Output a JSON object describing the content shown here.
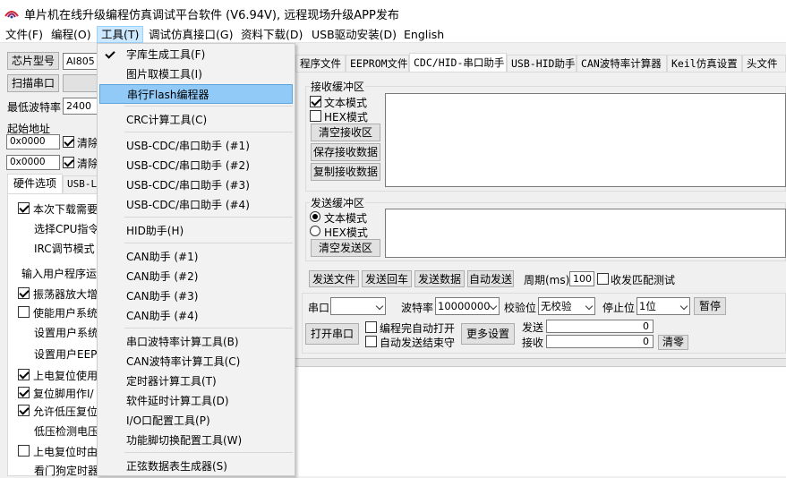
{
  "window": {
    "title": "单片机在线升级编程仿真调试平台软件 (V6.94V), 远程现场升级APP发布"
  },
  "menubar": {
    "file": "文件(F)",
    "program": "编程(O)",
    "tools": "工具(T)",
    "debug": "调试仿真接口(G)",
    "download": "资料下载(D)",
    "usb": "USB驱动安装(D)",
    "english": "English"
  },
  "left": {
    "chip_label": "芯片型号",
    "chip_value": "AI805",
    "scan_port": "扫描串口",
    "min_baud_label": "最低波特率",
    "min_baud_value": "2400",
    "start_addr_label": "起始地址",
    "addr1": "0x0000",
    "clear1": "清除",
    "addr2": "0x0000",
    "clear2": "清除",
    "tab_hw": "硬件选项",
    "tab_usb": "USB-L",
    "items": [
      {
        "label": "本次下载需要",
        "checked": true
      },
      {
        "label": "选择CPU指令",
        "checked": null
      },
      {
        "label": "IRC调节模式",
        "checked": null
      },
      {
        "label": "输入用户程序运",
        "checked": null
      },
      {
        "label": "振荡器放大增",
        "checked": true
      },
      {
        "label": "使能用户系统",
        "checked": false
      },
      {
        "label": "设置用户系统",
        "checked": null
      },
      {
        "label": "设置用户EEPR",
        "checked": null
      },
      {
        "label": "上电复位使用",
        "checked": true
      },
      {
        "label": "复位脚用作I/",
        "checked": true
      },
      {
        "label": "允许低压复位",
        "checked": true
      },
      {
        "label": "低压检测电压",
        "checked": null
      },
      {
        "label": "上电复位时由",
        "checked": false
      },
      {
        "label": "看门狗定时器",
        "checked": null
      }
    ]
  },
  "tabs": [
    "程序文件",
    "EEPROM文件",
    "CDC/HID-串口助手",
    "USB-HID助手",
    "CAN波特率计算器",
    "Keil仿真设置",
    "头文件"
  ],
  "receive": {
    "title": "接收缓冲区",
    "text_mode": "文本模式",
    "hex_mode": "HEX模式",
    "clear": "清空接收区",
    "save": "保存接收数据",
    "copy": "复制接收数据"
  },
  "send": {
    "title": "发送缓冲区",
    "text_mode": "文本模式",
    "hex_mode": "HEX模式",
    "clear": "清空发送区",
    "send_file": "发送文件",
    "send_return": "发送回车",
    "send_data": "发送数据",
    "auto_send": "自动发送",
    "period_label": "周期(ms)",
    "period_value": "100",
    "match_test": "收发匹配测试"
  },
  "serial": {
    "port_label": "串口",
    "baud_label": "波特率",
    "baud_value": "10000000",
    "parity_label": "校验位",
    "parity_value": "无校验",
    "stop_label": "停止位",
    "stop_value": "1位",
    "pause": "暂停",
    "open": "打开串口",
    "auto_open": "编程完自动打开",
    "auto_close": "自动发送结束守",
    "more": "更多设置",
    "send_label": "发送",
    "send_count": "0",
    "recv_label": "接收",
    "recv_count": "0",
    "clear": "清零"
  },
  "dropdown": {
    "items": [
      "字库生成工具(F)",
      "图片取模工具(I)",
      "串行Flash编程器",
      "CRC计算工具(C)",
      "USB-CDC/串口助手 (#1)",
      "USB-CDC/串口助手 (#2)",
      "USB-CDC/串口助手 (#3)",
      "USB-CDC/串口助手 (#4)",
      "HID助手(H)",
      "CAN助手 (#1)",
      "CAN助手 (#2)",
      "CAN助手 (#3)",
      "CAN助手 (#4)",
      "串口波特率计算工具(B)",
      "CAN波特率计算工具(C)",
      "定时器计算工具(T)",
      "软件延时计算工具(D)",
      "I/O口配置工具(P)",
      "功能脚切换配置工具(W)",
      "正弦数据表生成器(S)"
    ]
  }
}
